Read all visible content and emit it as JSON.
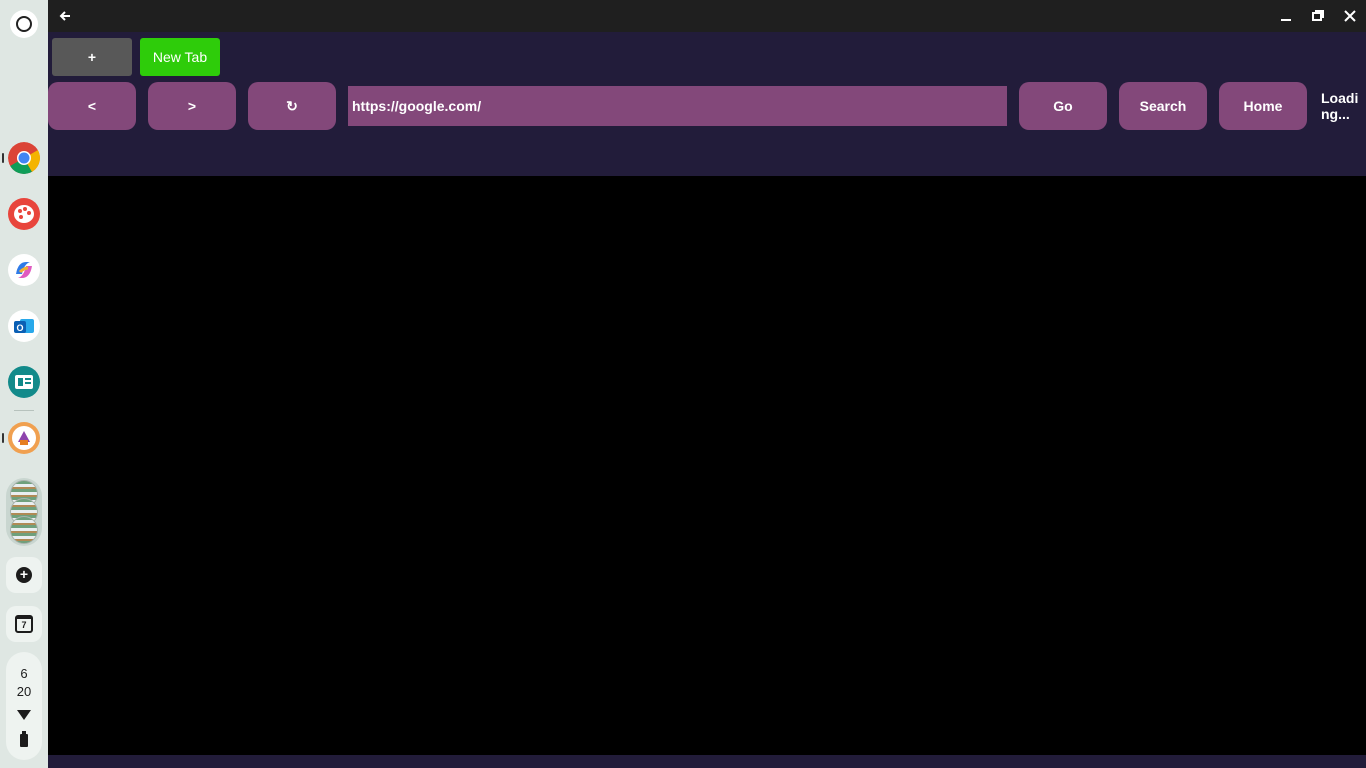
{
  "window": {
    "back_icon": "arrow-left-icon",
    "minimize_icon": "minimize-icon",
    "restore_icon": "restore-icon",
    "close_icon": "close-icon"
  },
  "toolbar": {
    "plus_label": "+",
    "new_tab_label": "New Tab",
    "back_label": "<",
    "forward_label": ">",
    "reload_label": "↻",
    "url_value": "https://google.com/",
    "go_label": "Go",
    "search_label": "Search",
    "home_label": "Home",
    "status_text": "Loading..."
  },
  "shelf": {
    "apps": [
      "chrome-icon",
      "paint-icon",
      "copilot-icon",
      "outlook-icon",
      "classroom-icon",
      "app-icon"
    ],
    "calendar_day": "7",
    "clock_hour": "6",
    "clock_minute": "20"
  },
  "colors": {
    "toolbar_bg": "#221c3a",
    "nav_button": "#83487a",
    "new_tab_button": "#2ecc0a",
    "plus_button": "#585858"
  }
}
